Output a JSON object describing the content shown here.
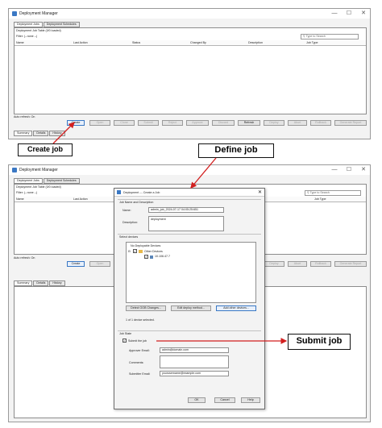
{
  "window_title": "Deployment Manager",
  "tabs": [
    "Deployment Jobs",
    "Deployment Schedules"
  ],
  "table_title": "Deployment Job Table (0/0 loaded)",
  "filter_label": "Filter: (--none --)",
  "search_placeholder": "Type to Search",
  "columns": [
    "Name",
    "Last Action",
    "Status",
    "Changed By",
    "Description",
    "Job Type"
  ],
  "auto_refresh": "Auto refresh: On",
  "buttons": [
    "Create",
    "Open",
    "Clone",
    "Submit",
    "Reject",
    "Approve",
    "Discard",
    "Refresh",
    "Deploy",
    "Abort",
    "Rollback",
    "Generate Report"
  ],
  "bottom_tabs": [
    "Summary",
    "Details",
    "History"
  ],
  "callouts": {
    "create_job": "Create job",
    "define_job": "Define job",
    "submit_job": "Submit job"
  },
  "dialog": {
    "title": "Deployment --- Create a Job",
    "section_name": "Job Name and Description",
    "name_label": "Name:",
    "name_value": "admin_job_2024-07-17 04:05:25:651",
    "description_label": "Description:",
    "description_value": "deployment",
    "section_devices": "Select devices",
    "no_deployable": "No Deployable Devices",
    "other_devices": "Other Devices",
    "device_ip": "10.106.47.7",
    "btn_detect": "Detect OOB Changes...",
    "btn_edit_deploy": "Edit deploy method...",
    "btn_add_other": "Add other devices...",
    "selected_count": "1 of 1 device selected.",
    "section_state": "Job State",
    "submit_label": "Submit the job",
    "approver_label": "Approver Email:",
    "approver_value": "admin@domain.com",
    "comments_label": "Comments:",
    "submitter_label": "Submitter Email:",
    "submitter_value": "yourusername@example.com",
    "ok": "OK",
    "cancel": "Cancel",
    "help": "Help"
  }
}
